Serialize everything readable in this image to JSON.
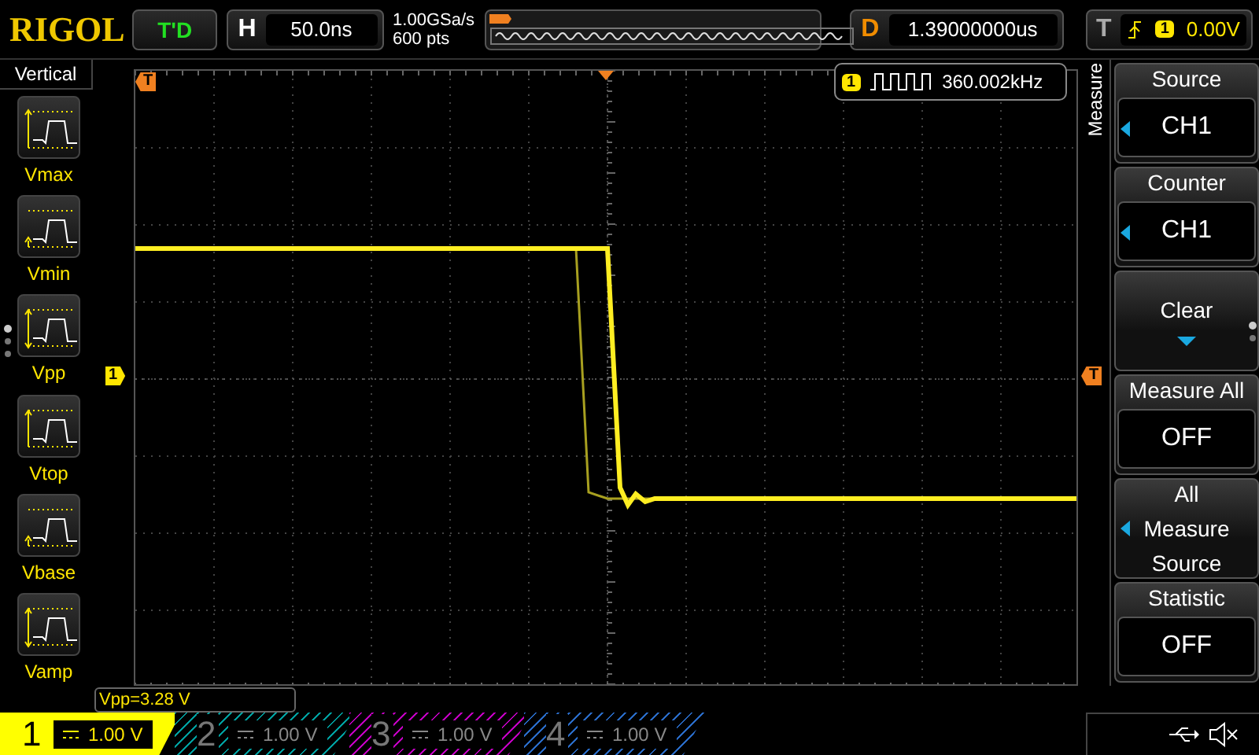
{
  "brand": "RIGOL",
  "run_status": "T'D",
  "timebase": {
    "label": "H",
    "value": "50.0ns"
  },
  "sampling": {
    "rate": "1.00GSa/s",
    "depth": "600 pts"
  },
  "delay": {
    "label": "D",
    "value": "1.39000000us"
  },
  "trigger": {
    "label": "T",
    "source": "1",
    "level": "0.00V"
  },
  "left_menu": {
    "title": "Vertical",
    "items": [
      {
        "kind": "max",
        "label": "Vmax"
      },
      {
        "kind": "min",
        "label": "Vmin"
      },
      {
        "kind": "pp",
        "label": "Vpp"
      },
      {
        "kind": "top",
        "label": "Vtop"
      },
      {
        "kind": "base",
        "label": "Vbase"
      },
      {
        "kind": "amp",
        "label": "Vamp"
      }
    ]
  },
  "markers": {
    "trigger_position": "T",
    "channel": "1",
    "trigger_level": "T"
  },
  "frequency_readout": {
    "channel": "1",
    "value": "360.002kHz"
  },
  "right_menu": {
    "title": "Measure",
    "items": [
      {
        "kind": "select",
        "label": "Source",
        "value": "CH1"
      },
      {
        "kind": "select",
        "label": "Counter",
        "value": "CH1"
      },
      {
        "kind": "action",
        "label": "Clear"
      },
      {
        "kind": "toggle",
        "label": "Measure All",
        "value": "OFF"
      },
      {
        "kind": "option",
        "label": "All Measure Source"
      },
      {
        "kind": "toggle",
        "label": "Statistic",
        "value": "OFF"
      }
    ]
  },
  "measurement": "Vpp=3.28 V",
  "channels": [
    {
      "number": "1",
      "scale": "1.00 V",
      "selected": true,
      "color": "#ffff00"
    },
    {
      "number": "2",
      "scale": "1.00 V",
      "selected": false,
      "color": "#00a0a0"
    },
    {
      "number": "3",
      "scale": "1.00 V",
      "selected": false,
      "color": "#c000c0"
    },
    {
      "number": "4",
      "scale": "1.00 V",
      "selected": false,
      "color": "#2a6cc8"
    }
  ]
}
